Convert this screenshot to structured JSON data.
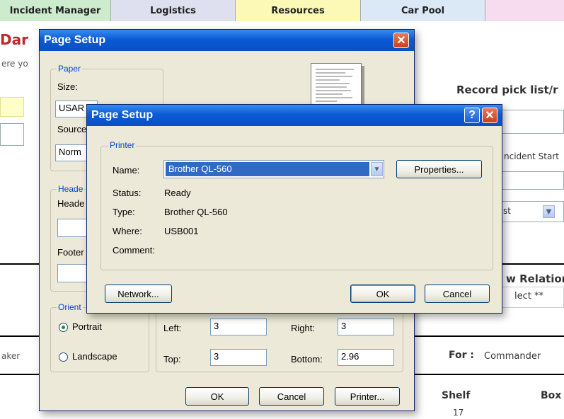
{
  "tabs": [
    "Incident Manager",
    "Logistics",
    "Resources",
    "Car Pool"
  ],
  "colors": {
    "tab_incident": "#cdeccd",
    "tab_logistics": "#dfe0ef",
    "tab_resources": "#fbf9b5",
    "tab_carpool": "#dbe8f6",
    "tab_last": "#f7dcef",
    "title_red": "#c0272d",
    "xp_title_blue": "#0a5bd6"
  },
  "background": {
    "title_fragment": "Dar",
    "intro_fragment": "ere yo",
    "record_pick": "Record pick list/r",
    "incident_start": "ncident Start",
    "select_fragment": "st",
    "relation_fragment": "w Relation",
    "select_placeholder": "lect **",
    "maker_fragment": "aker",
    "for_label": "For :",
    "for_value": "Commander",
    "shelf_header": "Shelf",
    "box_header": "Box",
    "shelf_value": "17"
  },
  "page_setup": {
    "title": "Page Setup",
    "paper_group": "Paper",
    "size_label": "Size:",
    "size_value": "USAR",
    "source_label": "Source",
    "source_value": "Norm",
    "headers_group": "Heade",
    "header_label": "Heade",
    "footer_label": "Footer",
    "orientation_group": "Orient",
    "portrait_label": "Portrait",
    "landscape_label": "Landscape",
    "orientation_selected": "Portrait",
    "left_label": "Left:",
    "left_value": "3",
    "right_label": "Right:",
    "right_value": "3",
    "top_label": "Top:",
    "top_value": "3",
    "bottom_label": "Bottom:",
    "bottom_value": "2.96",
    "ok": "OK",
    "cancel": "Cancel",
    "printer": "Printer..."
  },
  "printer_dialog": {
    "title": "Page Setup",
    "printer_group": "Printer",
    "name_label": "Name:",
    "name_value": "Brother QL-560",
    "properties": "Properties...",
    "status_label": "Status:",
    "status_value": "Ready",
    "type_label": "Type:",
    "type_value": "Brother QL-560",
    "where_label": "Where:",
    "where_value": "USB001",
    "comment_label": "Comment:",
    "comment_value": "",
    "network": "Network...",
    "ok": "OK",
    "cancel": "Cancel"
  }
}
